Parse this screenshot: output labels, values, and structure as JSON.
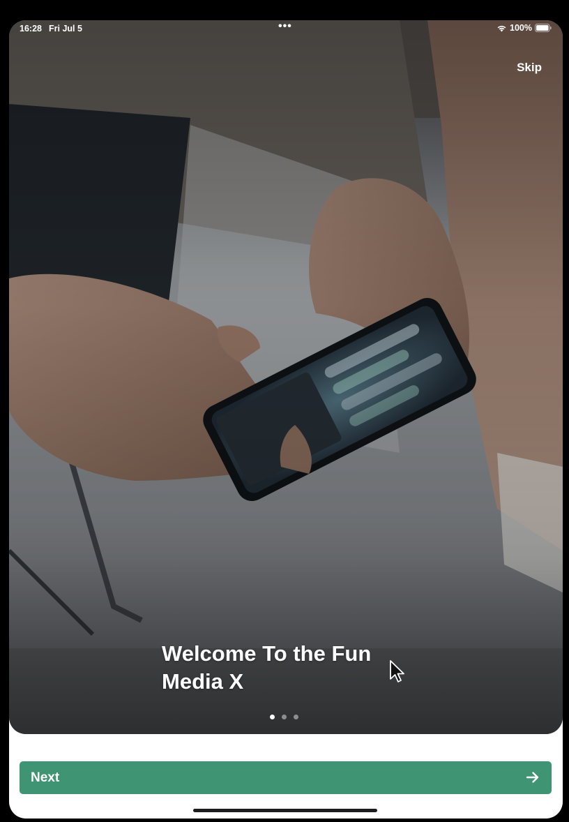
{
  "status_bar": {
    "time": "16:28",
    "date": "Fri Jul 5",
    "dots": "•••",
    "battery": "100%"
  },
  "onboarding": {
    "skip_label": "Skip",
    "title_line1": "Welcome To the Fun",
    "title_line2": "Media X",
    "pages_total": 3,
    "current_page": 1
  },
  "footer": {
    "next_label": "Next"
  },
  "colors": {
    "accent": "#3f9473",
    "background": "#ffffff"
  },
  "icons": [
    "wifi-icon",
    "battery-icon",
    "arrow-right-icon",
    "mouse-cursor-icon"
  ]
}
